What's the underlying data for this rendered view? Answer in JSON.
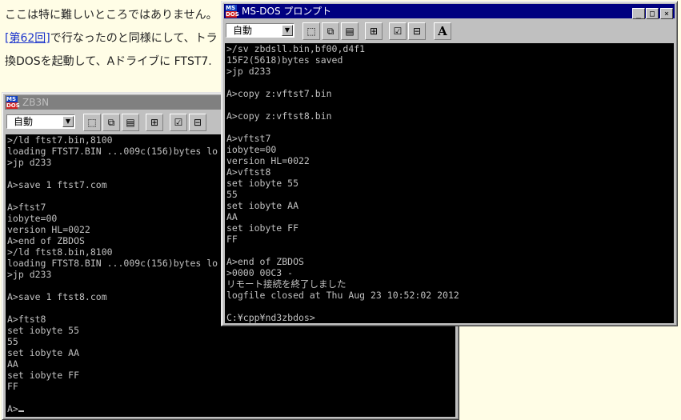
{
  "page": {
    "line1": "ここは特に難しいところではありません。",
    "line2_link": "[第62回]",
    "line2_rest": "で行なったのと同様にして、トラ",
    "line3": "換DOSを起動して、Aドライブに FTST7."
  },
  "toolbar": {
    "select_value": "自動",
    "font_label": "A"
  },
  "window_zb3n": {
    "title": "ZB3N",
    "lines": [
      ">/ld ftst7.bin,8100",
      "loading FTST7.BIN ...009c(156)bytes lo",
      ">jp d233",
      "",
      "A>save 1 ftst7.com",
      "",
      "A>ftst7",
      "iobyte=00",
      "version HL=0022",
      "A>end of ZBDOS",
      ">/ld ftst8.bin,8100",
      "loading FTST8.BIN ...009c(156)bytes lo",
      ">jp d233",
      "",
      "A>save 1 ftst8.com",
      "",
      "A>ftst8",
      "set iobyte 55",
      "55",
      "set iobyte AA",
      "AA",
      "set iobyte FF",
      "FF",
      "",
      "A>"
    ]
  },
  "window_msdos": {
    "title": "MS-DOS プロンプト",
    "lines": [
      ">/sv zbdsll.bin,bf00,d4f1",
      "15F2(5618)bytes saved",
      ">jp d233",
      "",
      "A>copy z:vftst7.bin",
      "",
      "A>copy z:vftst8.bin",
      "",
      "A>vftst7",
      "iobyte=00",
      "version HL=0022",
      "A>vftst8",
      "set iobyte 55",
      "55",
      "set iobyte AA",
      "AA",
      "set iobyte FF",
      "FF",
      "",
      "A>end of ZBDOS",
      ">0000 00C3 -",
      "リモート接続を終了しました",
      "logfile closed at Thu Aug 23 10:52:02 2012",
      "",
      "C:¥cpp¥nd3zbdos>"
    ]
  },
  "icons": {
    "app": "msdos-icon",
    "mark": "mark-icon",
    "copy": "copy-icon",
    "paste": "paste-icon",
    "fullscreen": "fullscreen-icon",
    "properties": "properties-icon",
    "background": "background-icon",
    "font": "font-icon"
  },
  "colors": {
    "page_bg": "#fffde6",
    "link": "#1a33cc",
    "active_title": "#000080",
    "inactive_title": "#808080",
    "console_bg": "#000000",
    "console_fg": "#c0c0c0"
  }
}
